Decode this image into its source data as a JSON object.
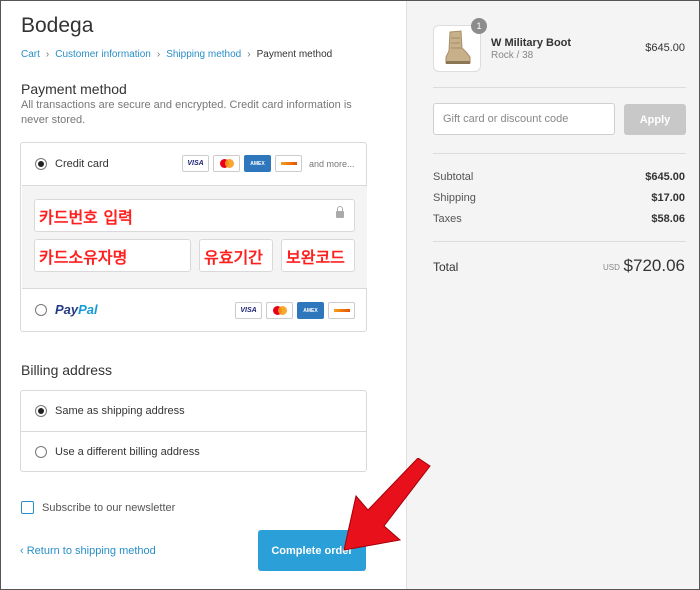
{
  "shop": {
    "title": "Bodega"
  },
  "breadcrumb": {
    "items": [
      "Cart",
      "Customer information",
      "Shipping method"
    ],
    "current": "Payment method"
  },
  "payment": {
    "title": "Payment method",
    "note": "All transactions are secure and encrypted. Credit card information is never stored.",
    "credit_card": {
      "label": "Credit card",
      "selected": true,
      "cards": [
        "VISA",
        "Mastercard",
        "AMEX",
        "Discover"
      ],
      "visa_text": "VISA",
      "amex_text": "AMEX",
      "more": "and more..."
    },
    "fields": {
      "card_number": "카드번호 입력",
      "name": "카드소유자명",
      "expiry": "유효기간",
      "cvv": "보완코드"
    },
    "paypal": {
      "selected": false,
      "pay": "Pay",
      "pal": "Pal"
    }
  },
  "billing": {
    "title": "Billing address",
    "options": [
      {
        "label": "Same as shipping address",
        "selected": true
      },
      {
        "label": "Use a different billing address",
        "selected": false
      }
    ]
  },
  "newsletter": {
    "label": "Subscribe to our newsletter",
    "checked": false
  },
  "footer": {
    "back_label": "Return to shipping method",
    "complete_label": "Complete order"
  },
  "order": {
    "product": {
      "name": "W Military Boot",
      "variant": "Rock / 38",
      "price": "$645.00",
      "quantity": "1"
    },
    "discount": {
      "placeholder": "Gift card or discount code",
      "apply_label": "Apply"
    },
    "summary": [
      {
        "label": "Subtotal",
        "value": "$645.00"
      },
      {
        "label": "Shipping",
        "value": "$17.00"
      },
      {
        "label": "Taxes",
        "value": "$58.06"
      }
    ],
    "total": {
      "label": "Total",
      "currency": "USD",
      "value": "$720.06"
    }
  },
  "colors": {
    "accent": "#2a9fd8",
    "link": "#2a8ec7",
    "annotation": "#ff1f1f",
    "arrow": "#e8101a"
  },
  "icons": [
    "lock-icon",
    "chevron-right-icon",
    "chevron-left-icon",
    "red-arrow-annotation"
  ]
}
